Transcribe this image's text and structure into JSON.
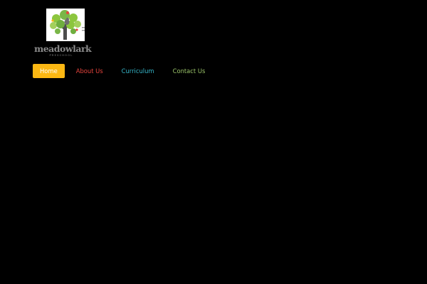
{
  "brand": {
    "name": "meadowlark",
    "tagline": "PRESCHOOL",
    "logo_icon": "tree-with-bird-icon"
  },
  "nav": {
    "items": [
      {
        "label": "Home",
        "active": true,
        "color": "#fcb813"
      },
      {
        "label": "About Us",
        "active": false,
        "color": "#e8443d"
      },
      {
        "label": "Curriculum",
        "active": false,
        "color": "#36b6c9"
      },
      {
        "label": "Contact Us",
        "active": false,
        "color": "#9bc46a"
      }
    ]
  },
  "colors": {
    "background": "#000000"
  }
}
